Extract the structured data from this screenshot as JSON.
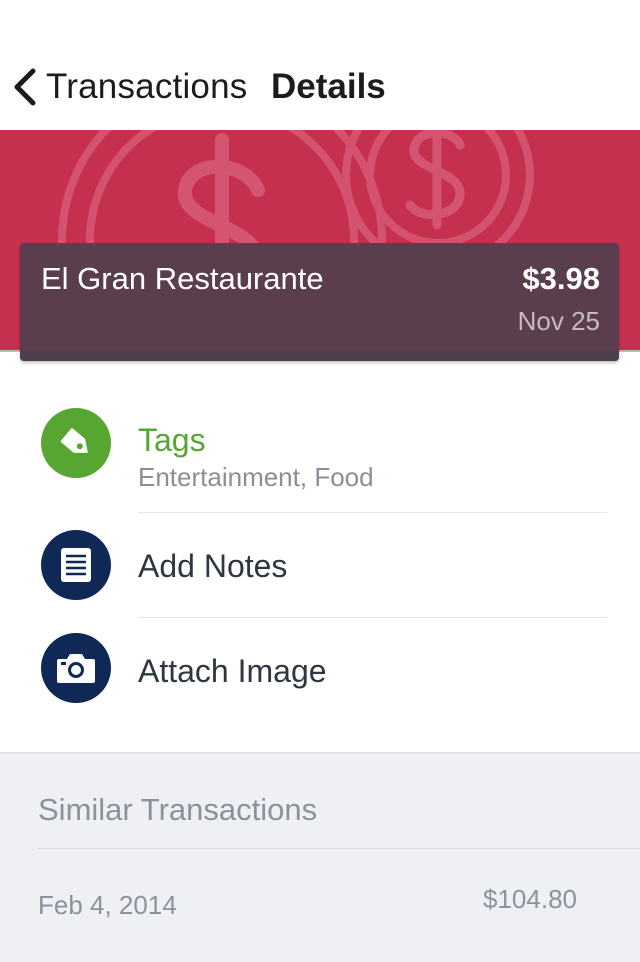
{
  "nav": {
    "back_label": "Transactions",
    "title": "Details"
  },
  "transaction": {
    "merchant": "El Gran Restaurante",
    "amount": "$3.98",
    "date": "Nov 25"
  },
  "actions": [
    {
      "title": "Tags",
      "subtitle": "Entertainment, Food",
      "icon": "tag-icon",
      "color": "#56a631"
    },
    {
      "title": "Add Notes",
      "icon": "notes-icon",
      "color": "#0f2855"
    },
    {
      "title": "Attach Image",
      "icon": "camera-icon",
      "color": "#0f2855"
    }
  ],
  "similar": {
    "title": "Similar Transactions",
    "items": [
      {
        "date": "Feb 4, 2014",
        "amount": "$104.80"
      }
    ]
  },
  "colors": {
    "hero": "#c5304f",
    "card": "#5b3e4e",
    "tag_accent": "#56a631",
    "navy": "#0f2855"
  }
}
